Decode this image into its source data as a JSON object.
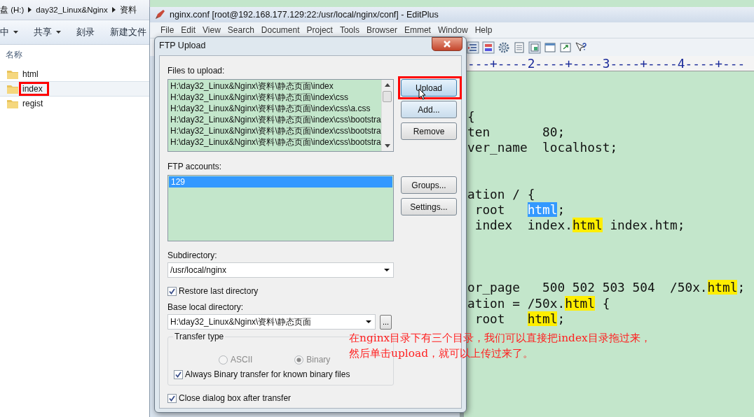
{
  "explorer": {
    "breadcrumb": [
      "盘 (H:)",
      "day32_Linux&Nginx",
      "资料"
    ],
    "toolbar": [
      {
        "label": "中",
        "dropdown": true
      },
      {
        "label": "共享",
        "dropdown": true
      },
      {
        "label": "刻录",
        "dropdown": false
      },
      {
        "label": "新建文件",
        "dropdown": false
      }
    ],
    "column_header": "名称",
    "items": [
      {
        "name": "html",
        "annotated": false
      },
      {
        "name": "index",
        "annotated": true
      },
      {
        "name": "regist",
        "annotated": false
      }
    ]
  },
  "editor_window": {
    "title": "nginx.conf [root@192.168.177.129:22:/usr/local/nginx/conf] - EditPlus",
    "menu": [
      "File",
      "Edit",
      "View",
      "Search",
      "Document",
      "Project",
      "Tools",
      "Browser",
      "Emmet",
      "Window",
      "Help"
    ],
    "ruler": "---+----2----+----3----+----4----+---",
    "blocks": [
      [
        [
          {
            "text": "{"
          }
        ],
        [
          {
            "text": "ten       80;"
          }
        ],
        [
          {
            "text": "ver_name  localhost;"
          }
        ]
      ],
      [
        [
          {
            "text": "ation / {"
          }
        ],
        [
          {
            "text": " root   "
          },
          {
            "text": "html",
            "selected": true
          },
          {
            "text": ";"
          }
        ],
        [
          {
            "text": " index  index."
          },
          {
            "text": "html",
            "selected": false,
            "highlighted": true
          },
          {
            "text": " index.htm;"
          }
        ]
      ],
      [
        [
          {
            "text": "or_page   500 502 503 504  /50x."
          },
          {
            "text": "html",
            "selected": false,
            "highlighted": true
          },
          {
            "text": ";"
          }
        ],
        [
          {
            "text": "ation = /50x."
          },
          {
            "text": "html",
            "selected": false,
            "highlighted": true
          },
          {
            "text": " {"
          }
        ],
        [
          {
            "text": " root   "
          },
          {
            "text": "html",
            "selected": false,
            "highlighted": true
          },
          {
            "text": ";"
          }
        ]
      ]
    ]
  },
  "dialog": {
    "title": "FTP Upload",
    "files_label": "Files to upload:",
    "files": [
      "H:\\day32_Linux&Nginx\\资料\\静态页面\\index",
      "H:\\day32_Linux&Nginx\\资料\\静态页面\\index\\css",
      "H:\\day32_Linux&Nginx\\资料\\静态页面\\index\\css\\a.css",
      "H:\\day32_Linux&Nginx\\资料\\静态页面\\index\\css\\bootstra",
      "H:\\day32_Linux&Nginx\\资料\\静态页面\\index\\css\\bootstra",
      "H:\\day32_Linux&Nginx\\资料\\静态页面\\index\\css\\bootstra"
    ],
    "file_buttons": [
      {
        "label": "Upload",
        "focused": true,
        "annotated": true
      },
      {
        "label": "Add...",
        "focused": false,
        "annotated": false
      },
      {
        "label": "Remove",
        "focused": false,
        "annotated": false
      }
    ],
    "accounts_label": "FTP accounts:",
    "accounts": [
      {
        "name": "129",
        "selected": true
      }
    ],
    "account_buttons": [
      "Groups...",
      "Settings..."
    ],
    "subdirectory_label": "Subdirectory:",
    "subdirectory": "/usr/local/nginx",
    "restore": {
      "label": "Restore last directory",
      "checked": true
    },
    "base_label": "Base local directory:",
    "base_directory": "H:\\day32_Linux&Nginx\\资料\\静态页面",
    "browse_button": "...",
    "transfer_type": {
      "title": "Transfer type",
      "options": [
        {
          "label": "ASCII",
          "selected": false
        },
        {
          "label": "Binary",
          "selected": true
        }
      ],
      "disabled": true,
      "always_binary": {
        "label": "Always Binary transfer for known binary files",
        "checked": true
      }
    },
    "close_after": {
      "label": "Close dialog box after transfer",
      "checked": true
    }
  },
  "note": [
    "在nginx目录下有三个目录，我们可以直接把index目录拖过来，",
    "然后单击upload，就可以上传过来了。"
  ]
}
